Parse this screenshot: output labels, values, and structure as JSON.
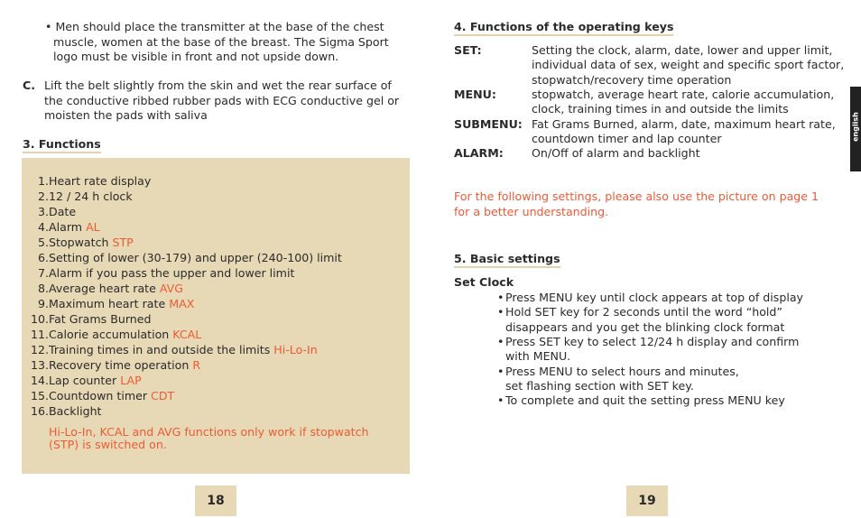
{
  "left_page": {
    "bullet_lines": [
      "Men should place the transmitter at the base of the chest",
      "muscle, women at the base of the breast. The Sigma Sport",
      "logo must be visible in front and not upside down."
    ],
    "step_c": {
      "label": "C.",
      "lines": [
        "Lift the belt slightly from the skin and wet the rear surface of",
        "the conductive ribbed rubber pads with ECG conductive gel or",
        "moisten the pads with saliva"
      ]
    },
    "functions_heading": "3. Functions",
    "functions": [
      {
        "num": "1.",
        "text": "Heart rate display",
        "code": ""
      },
      {
        "num": "2.",
        "text": "12 / 24 h clock",
        "code": ""
      },
      {
        "num": "3.",
        "text": "Date",
        "code": ""
      },
      {
        "num": "4.",
        "text": "Alarm ",
        "code": "AL"
      },
      {
        "num": "5.",
        "text": "Stopwatch ",
        "code": "STP"
      },
      {
        "num": "6.",
        "text": "Setting of lower (30-179) and upper (240-100) limit",
        "code": ""
      },
      {
        "num": "7.",
        "text": "Alarm if you pass the upper and lower limit",
        "code": ""
      },
      {
        "num": "8.",
        "text": "Average heart rate ",
        "code": "AVG"
      },
      {
        "num": "9.",
        "text": "Maximum heart rate ",
        "code": "MAX"
      },
      {
        "num": "10.",
        "text": "Fat Grams Burned",
        "code": ""
      },
      {
        "num": "11.",
        "text": "Calorie accumulation ",
        "code": "KCAL"
      },
      {
        "num": "12.",
        "text": "Training times in and outside the limits ",
        "code": "Hi-Lo-In"
      },
      {
        "num": "13.",
        "text": "Recovery time operation ",
        "code": "R"
      },
      {
        "num": "14.",
        "text": "Lap counter ",
        "code": "LAP"
      },
      {
        "num": "15.",
        "text": "Countdown timer ",
        "code": "CDT"
      },
      {
        "num": "16.",
        "text": "Backlight",
        "code": ""
      }
    ],
    "note_lines": [
      "Hi-Lo-In, KCAL and AVG functions only work if stopwatch",
      "(STP) is switched on."
    ],
    "page_number": "18"
  },
  "right_page": {
    "keys_heading": "4. Functions of the operating keys",
    "keys": [
      {
        "key": "SET:",
        "lines": [
          "Setting the clock, alarm, date, lower and upper limit,",
          "individual data of sex, weight and specific sport factor,",
          "stopwatch/recovery time operation"
        ]
      },
      {
        "key": "MENU:",
        "lines": [
          "stopwatch, average heart rate, calorie accumulation,",
          "clock, training times in and outside the limits"
        ]
      },
      {
        "key": "SUBMENU:",
        "lines": [
          "Fat Grams Burned, alarm, date, maximum heart rate,",
          "countdown timer and lap counter"
        ]
      },
      {
        "key": "ALARM:",
        "lines": [
          "On/Off of alarm and backlight"
        ]
      }
    ],
    "hint_lines": [
      "For the following settings, please also use the picture on page 1",
      "for a better understanding."
    ],
    "basic_heading": "5. Basic settings",
    "set_clock_heading": "Set Clock",
    "set_clock_steps": [
      [
        "Press MENU key until clock appears at top of display"
      ],
      [
        "Hold SET key for 2 seconds until the word “hold”",
        "disappears and you get the blinking clock format"
      ],
      [
        "Press SET key to select 12/24 h display and confirm",
        "with MENU."
      ],
      [
        "Press MENU to select hours and minutes,",
        "set flashing section with SET key."
      ],
      [
        "To complete and quit the setting press MENU key"
      ]
    ],
    "language_tab": "english",
    "page_number": "19"
  },
  "colors": {
    "accent_box": "#e8d9b6",
    "highlight_text": "#ee5a36",
    "tab": "#222222"
  }
}
